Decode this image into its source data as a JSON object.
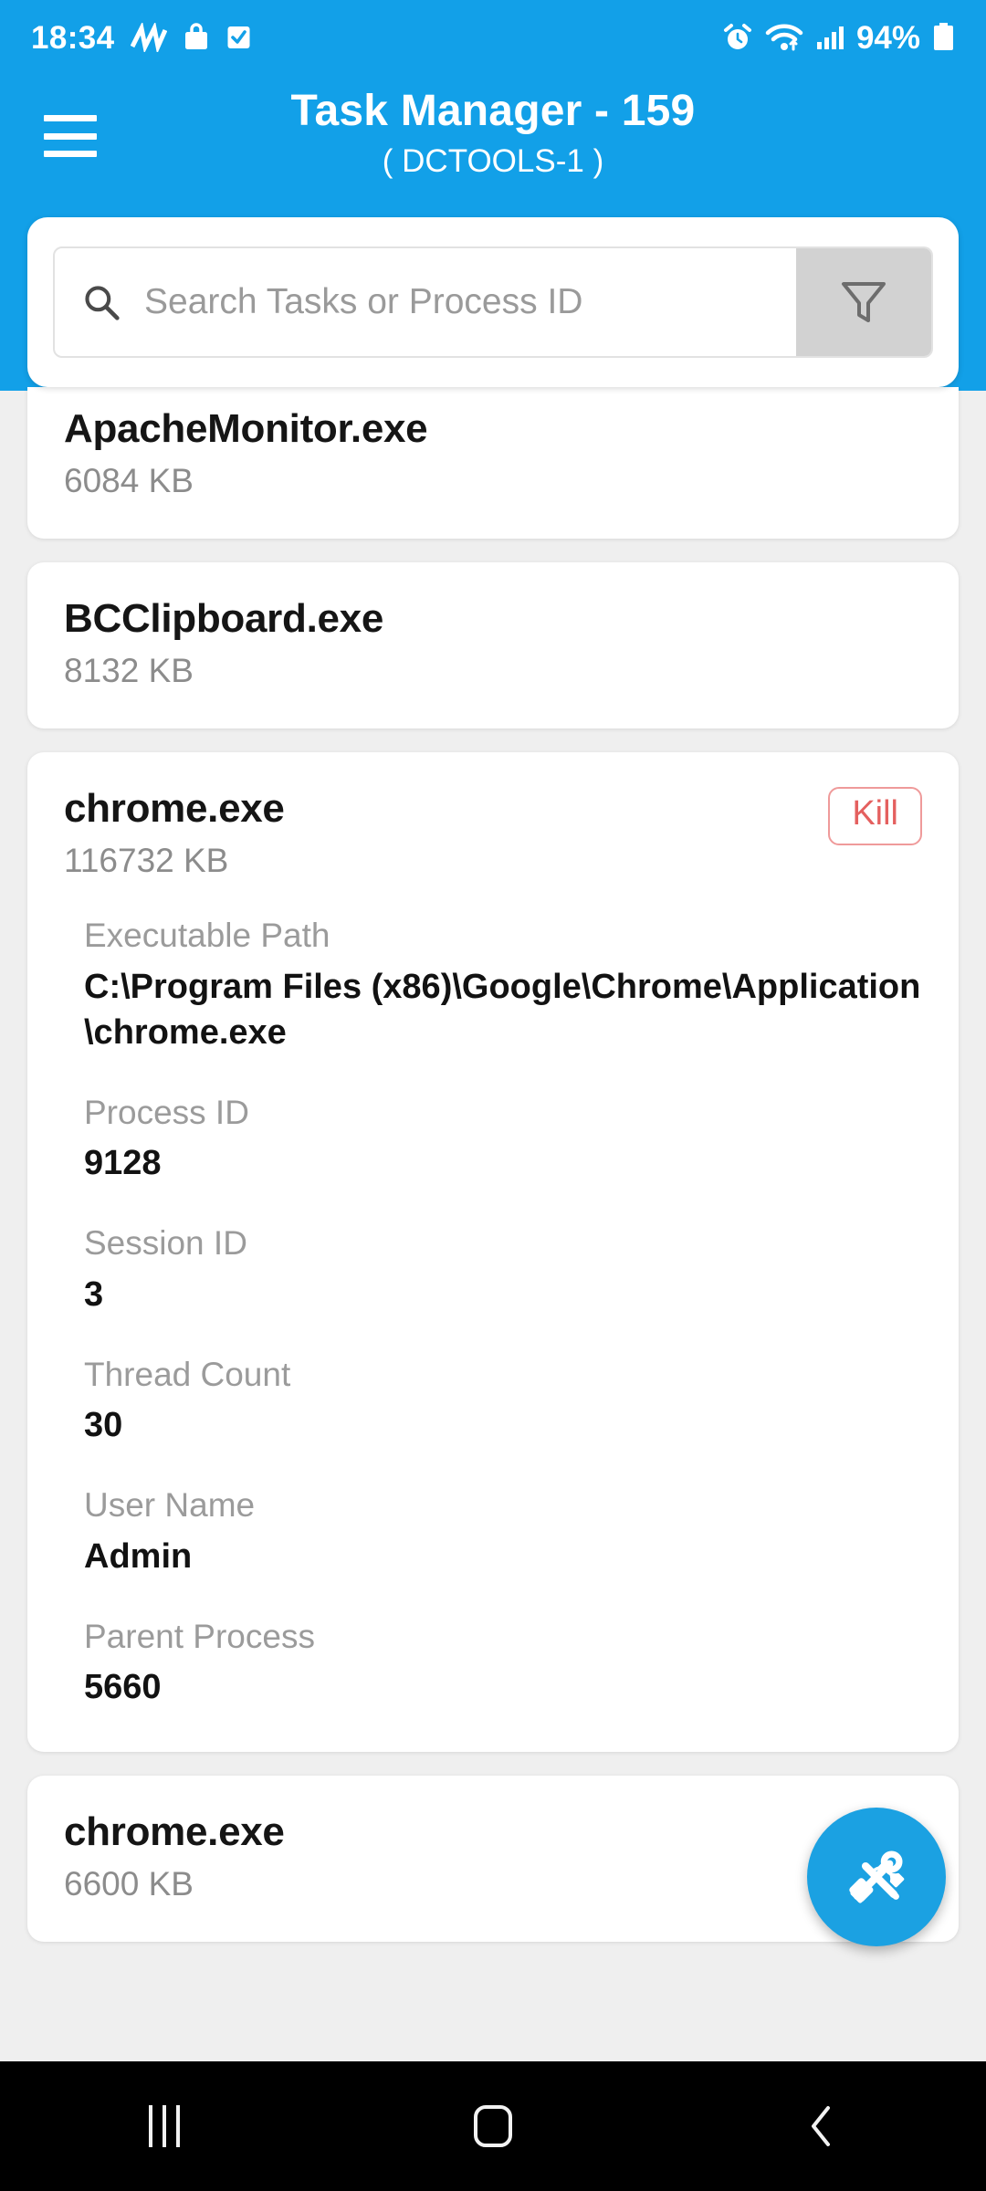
{
  "statusbar": {
    "time": "18:34",
    "battery_percent": "94%",
    "left_icons": [
      "motion-icon",
      "bag-icon",
      "checkbox-icon"
    ],
    "right_icons": [
      "alarm-icon",
      "wifi-icon",
      "signal-icon",
      "battery-icon"
    ]
  },
  "header": {
    "menu_icon": "hamburger-menu-icon",
    "title": "Task Manager - 159",
    "subtitle": "( DCTOOLS-1 )",
    "background_color": "#12A0E8"
  },
  "search": {
    "placeholder": "Search Tasks or Process ID",
    "value": "",
    "icon": "search-icon",
    "filter_icon": "filter-funnel-icon"
  },
  "tasks": [
    {
      "name": "ApacheMonitor.exe",
      "memory": "6084 KB",
      "expanded": false
    },
    {
      "name": "BCClipboard.exe",
      "memory": "8132 KB",
      "expanded": false
    },
    {
      "name": "chrome.exe",
      "memory": "116732 KB",
      "expanded": true,
      "kill_label": "Kill",
      "details": [
        {
          "label": "Executable Path",
          "value": "C:\\Program Files (x86)\\Google\\Chrome\\Application\\chrome.exe"
        },
        {
          "label": "Process ID",
          "value": "9128"
        },
        {
          "label": "Session ID",
          "value": "3"
        },
        {
          "label": "Thread Count",
          "value": "30"
        },
        {
          "label": "User Name",
          "value": "Admin"
        },
        {
          "label": "Parent Process",
          "value": "5660"
        }
      ]
    },
    {
      "name": "chrome.exe",
      "memory": "6600 KB",
      "expanded": false
    }
  ],
  "fab": {
    "icon": "tools-icon",
    "color": "#1BA1E2"
  },
  "navbar": {
    "recents_icon": "recents-icon",
    "home_icon": "home-icon",
    "back_icon": "back-icon"
  },
  "colors": {
    "accent": "#12A0E8",
    "kill": "#e4605f",
    "page_bg": "#efefef"
  }
}
